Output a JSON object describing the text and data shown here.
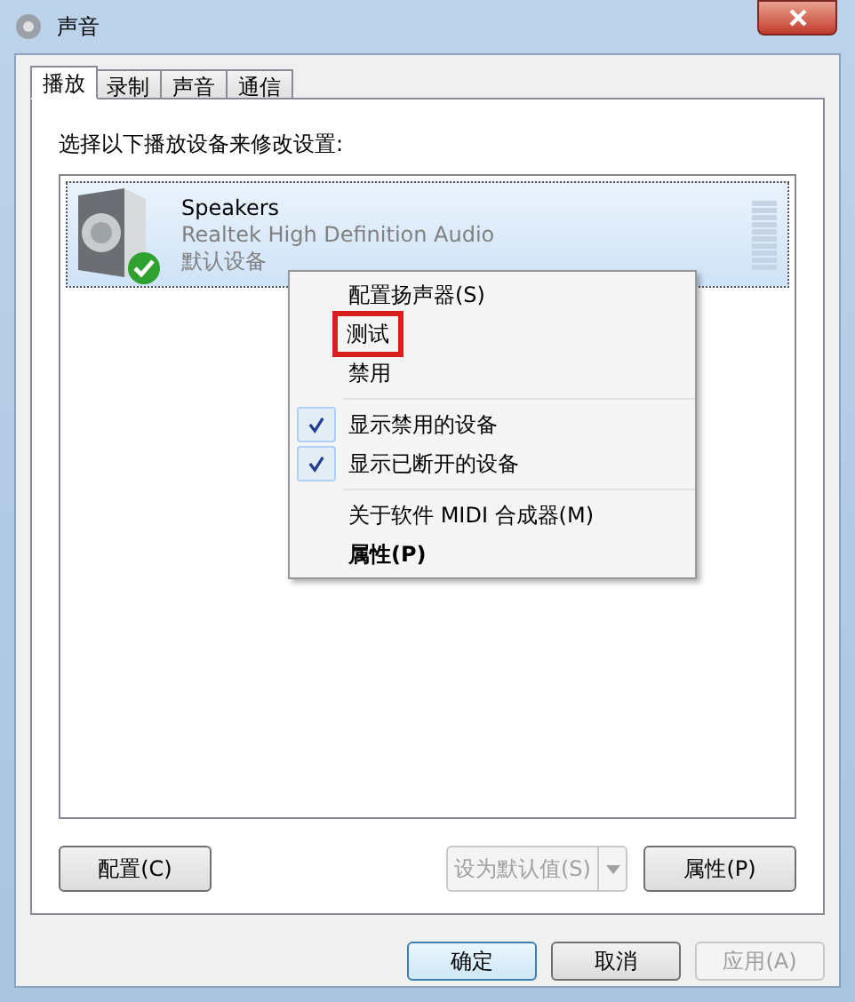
{
  "window": {
    "title": "声音"
  },
  "tabs": [
    {
      "label": "播放",
      "selected": true
    },
    {
      "label": "录制",
      "selected": false
    },
    {
      "label": "声音",
      "selected": false
    },
    {
      "label": "通信",
      "selected": false
    }
  ],
  "instruction": "选择以下播放设备来修改设置:",
  "devices": [
    {
      "name": "Speakers",
      "driver": "Realtek High Definition Audio",
      "status": "默认设备",
      "selected": true,
      "is_default": true,
      "level": 0
    }
  ],
  "context_menu": [
    {
      "kind": "item",
      "label": "配置扬声器(S)",
      "checked": false,
      "bold": false,
      "highlighted": false
    },
    {
      "kind": "item",
      "label": "测试",
      "checked": false,
      "bold": false,
      "highlighted": true
    },
    {
      "kind": "item",
      "label": "禁用",
      "checked": false,
      "bold": false,
      "highlighted": false
    },
    {
      "kind": "separator"
    },
    {
      "kind": "item",
      "label": "显示禁用的设备",
      "checked": true,
      "bold": false,
      "highlighted": false
    },
    {
      "kind": "item",
      "label": "显示已断开的设备",
      "checked": true,
      "bold": false,
      "highlighted": false
    },
    {
      "kind": "separator"
    },
    {
      "kind": "item",
      "label": "关于软件 MIDI 合成器(M)",
      "checked": false,
      "bold": false,
      "highlighted": false
    },
    {
      "kind": "item",
      "label": "属性(P)",
      "checked": false,
      "bold": true,
      "highlighted": false
    }
  ],
  "panel_buttons": {
    "configure": {
      "label": "配置(C)",
      "disabled": false
    },
    "set_default": {
      "label": "设为默认值(S)",
      "disabled": true
    },
    "properties": {
      "label": "属性(P)",
      "disabled": false
    }
  },
  "dialog_buttons": [
    {
      "label": "确定",
      "disabled": false,
      "default": true
    },
    {
      "label": "取消",
      "disabled": false,
      "default": false
    },
    {
      "label": "应用(A)",
      "disabled": true,
      "default": false
    }
  ]
}
